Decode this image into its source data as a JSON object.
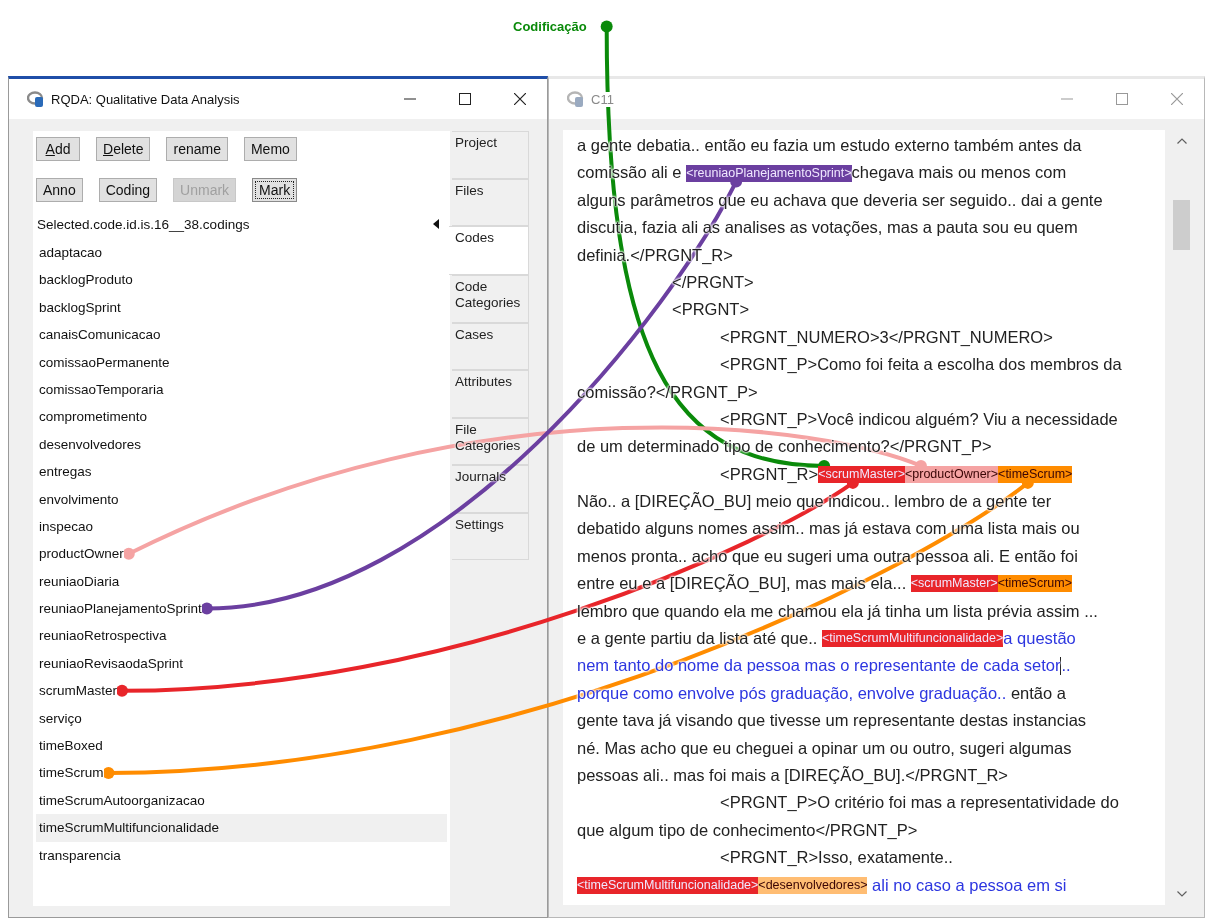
{
  "annotation": {
    "text": "Codificação",
    "color": "#0a8a0a"
  },
  "main_window": {
    "title": "RQDA: Qualitative Data Analysis",
    "active": true,
    "buttons": [
      {
        "label": "Add",
        "mnemonic": true,
        "disabled": false,
        "focused": false
      },
      {
        "label": "Delete",
        "mnemonic": true,
        "disabled": false,
        "focused": false
      },
      {
        "label": "rename",
        "mnemonic": false,
        "disabled": false,
        "focused": false
      },
      {
        "label": "Memo",
        "mnemonic": false,
        "disabled": false,
        "focused": false
      },
      {
        "label": "Anno",
        "mnemonic": false,
        "disabled": false,
        "focused": false
      },
      {
        "label": "Coding",
        "mnemonic": false,
        "disabled": false,
        "focused": false
      },
      {
        "label": "Unmark",
        "mnemonic": false,
        "disabled": true,
        "focused": false
      },
      {
        "label": "Mark",
        "mnemonic": false,
        "disabled": false,
        "focused": true
      }
    ],
    "list_header": "Selected.code.id.is.16__38.codings",
    "codes": [
      {
        "label": "adaptacao",
        "selected": false
      },
      {
        "label": "backlogProduto",
        "selected": false
      },
      {
        "label": "backlogSprint",
        "selected": false
      },
      {
        "label": "canaisComunicacao",
        "selected": false
      },
      {
        "label": "comissaoPermanente",
        "selected": false
      },
      {
        "label": "comissaoTemporaria",
        "selected": false
      },
      {
        "label": "comprometimento",
        "selected": false
      },
      {
        "label": "desenvolvedores",
        "selected": false
      },
      {
        "label": "entregas",
        "selected": false
      },
      {
        "label": "envolvimento",
        "selected": false
      },
      {
        "label": "inspecao",
        "selected": false
      },
      {
        "label": "productOwner",
        "selected": false,
        "color": "#f5a3a3"
      },
      {
        "label": "reuniaoDiaria",
        "selected": false
      },
      {
        "label": "reuniaoPlanejamentoSprint",
        "selected": false,
        "color": "#6b3fa0"
      },
      {
        "label": "reuniaoRetrospectiva",
        "selected": false
      },
      {
        "label": "reuniaoRevisaodaSprint",
        "selected": false
      },
      {
        "label": "scrumMaster",
        "selected": false,
        "color": "#e8252a"
      },
      {
        "label": "serviço",
        "selected": false
      },
      {
        "label": "timeBoxed",
        "selected": false
      },
      {
        "label": "timeScrum",
        "selected": false,
        "color": "#ff8c00"
      },
      {
        "label": "timeScrumAutoorganizacao",
        "selected": false
      },
      {
        "label": "timeScrumMultifuncionalidade",
        "selected": true
      },
      {
        "label": "transparencia",
        "selected": false
      }
    ],
    "tabs": [
      {
        "label": "Project",
        "selected": false
      },
      {
        "label": "Files",
        "selected": false
      },
      {
        "label": "Codes",
        "selected": true
      },
      {
        "label": "Code Categories",
        "selected": false
      },
      {
        "label": "Cases",
        "selected": false
      },
      {
        "label": "Attributes",
        "selected": false
      },
      {
        "label": "File Categories",
        "selected": false
      },
      {
        "label": "Journals",
        "selected": false
      },
      {
        "label": "Settings",
        "selected": false
      }
    ]
  },
  "document_window": {
    "title": "C11",
    "active": false,
    "lines": [
      {
        "kind": "plain",
        "segments": [
          {
            "kind": "text",
            "text": "a gente debatia.. então eu fazia um estudo externo também antes da"
          }
        ]
      },
      {
        "kind": "plain",
        "segments": [
          {
            "kind": "text",
            "text": "comissão ali e "
          },
          {
            "kind": "tag",
            "text": "<reuniaoPlanejamentoSprint>",
            "color": "#6b3fa0"
          },
          {
            "kind": "text",
            "text": "chegava mais ou menos com"
          }
        ]
      },
      {
        "kind": "plain",
        "segments": [
          {
            "kind": "text",
            "text": "alguns parâmetros que eu achava que deveria ser seguido.. dai a gente"
          }
        ]
      },
      {
        "kind": "plain",
        "segments": [
          {
            "kind": "text",
            "text": "discutia, fazia ali as analises as votações, mas a pauta sou eu quem"
          }
        ]
      },
      {
        "kind": "plain",
        "segments": [
          {
            "kind": "text",
            "text": "definia.</PRGNT_R>"
          }
        ]
      },
      {
        "kind": "tab",
        "segments": [
          {
            "kind": "text",
            "text": "</PRGNT>"
          }
        ]
      },
      {
        "kind": "tab",
        "segments": [
          {
            "kind": "text",
            "text": "<PRGNT>"
          }
        ]
      },
      {
        "kind": "tab2",
        "segments": [
          {
            "kind": "text",
            "text": "<PRGNT_NUMERO>3</PRGNT_NUMERO>"
          }
        ]
      },
      {
        "kind": "tab2",
        "segments": [
          {
            "kind": "text",
            "text": "<PRGNT_P>Como foi feita a escolha dos membros da"
          }
        ]
      },
      {
        "kind": "plain",
        "segments": [
          {
            "kind": "text",
            "text": "comissão?</PRGNT_P>"
          }
        ]
      },
      {
        "kind": "tab2",
        "segments": [
          {
            "kind": "text",
            "text": "<PRGNT_P>Você indicou alguém? Viu a necessidade"
          }
        ]
      },
      {
        "kind": "plain",
        "segments": [
          {
            "kind": "text",
            "text": "de um determinado tipo de conhecimento?</PRGNT_P>"
          }
        ]
      },
      {
        "kind": "tab2",
        "segments": [
          {
            "kind": "text",
            "text": "<PRGNT_R>"
          },
          {
            "kind": "tag",
            "text": "<scrumMaster>",
            "color": "#e8252a",
            "annotated": true
          },
          {
            "kind": "tag",
            "text": "<productOwner>",
            "color": "#f5a3a3"
          },
          {
            "kind": "tag",
            "text": "<timeScrum>",
            "color": "#ff8c00"
          }
        ]
      },
      {
        "kind": "plain",
        "segments": [
          {
            "kind": "text",
            "text": "Não.. a [DIREÇÃO_BU] meio que indicou.. lembro de a gente ter"
          }
        ]
      },
      {
        "kind": "plain",
        "segments": [
          {
            "kind": "text",
            "text": "debatido alguns nomes assim.. mas já estava com uma lista mais ou"
          }
        ]
      },
      {
        "kind": "plain",
        "segments": [
          {
            "kind": "text",
            "text": "menos pronta.. acho que eu sugeri uma outra pessoa ali. E então foi"
          }
        ]
      },
      {
        "kind": "plain",
        "segments": [
          {
            "kind": "text",
            "text": "entre eu e a [DIREÇÃO_BU], mas mais ela... "
          },
          {
            "kind": "tag",
            "text": "<scrumMaster>",
            "color": "#e8252a"
          },
          {
            "kind": "tag",
            "text": "<timeScrum>",
            "color": "#ff8c00"
          }
        ]
      },
      {
        "kind": "plain",
        "segments": [
          {
            "kind": "text",
            "text": "lembro que quando ela me chamou ela já tinha um lista prévia assim ..."
          }
        ]
      },
      {
        "kind": "plain",
        "segments": [
          {
            "kind": "text",
            "text": "e a gente partiu da lista até que.. "
          },
          {
            "kind": "tag",
            "text": "<timeScrumMultifuncionalidade>",
            "color": "#e8252a"
          },
          {
            "kind": "coded",
            "text": "a questão"
          }
        ]
      },
      {
        "kind": "plain",
        "segments": [
          {
            "kind": "coded",
            "text": "nem tanto do nome da pessoa mas o representante de cada setor"
          },
          {
            "kind": "cursor"
          },
          {
            "kind": "coded",
            "text": ".."
          }
        ]
      },
      {
        "kind": "plain",
        "segments": [
          {
            "kind": "coded",
            "text": "porque como envolve pós graduação, envolve graduação.."
          },
          {
            "kind": "text",
            "text": " então a"
          }
        ]
      },
      {
        "kind": "plain",
        "segments": [
          {
            "kind": "text",
            "text": "gente tava já visando que tivesse um representante destas instancias"
          }
        ]
      },
      {
        "kind": "plain",
        "segments": [
          {
            "kind": "text",
            "text": "né. Mas acho que eu cheguei a opinar um ou outro, sugeri algumas"
          }
        ]
      },
      {
        "kind": "plain",
        "segments": [
          {
            "kind": "text",
            "text": "pessoas ali.. mas foi mais a [DIREÇÃO_BU].</PRGNT_R>"
          }
        ]
      },
      {
        "kind": "tab2",
        "segments": [
          {
            "kind": "text",
            "text": "<PRGNT_P>O critério foi mas a representatividade do"
          }
        ]
      },
      {
        "kind": "plain",
        "segments": [
          {
            "kind": "text",
            "text": "que algum tipo de conhecimento</PRGNT_P>"
          }
        ]
      },
      {
        "kind": "tab2",
        "segments": [
          {
            "kind": "text",
            "text": "<PRGNT_R>Isso, exatamente.."
          }
        ]
      },
      {
        "kind": "plain",
        "segments": [
          {
            "kind": "tag",
            "text": "<timeScrumMultifuncionalidade>",
            "color": "#e8252a"
          },
          {
            "kind": "tag",
            "text": "<desenvolvedores>",
            "color": "#ffbd73"
          },
          {
            "kind": "coded",
            "text": " ali no caso a pessoa em si"
          }
        ]
      }
    ]
  }
}
